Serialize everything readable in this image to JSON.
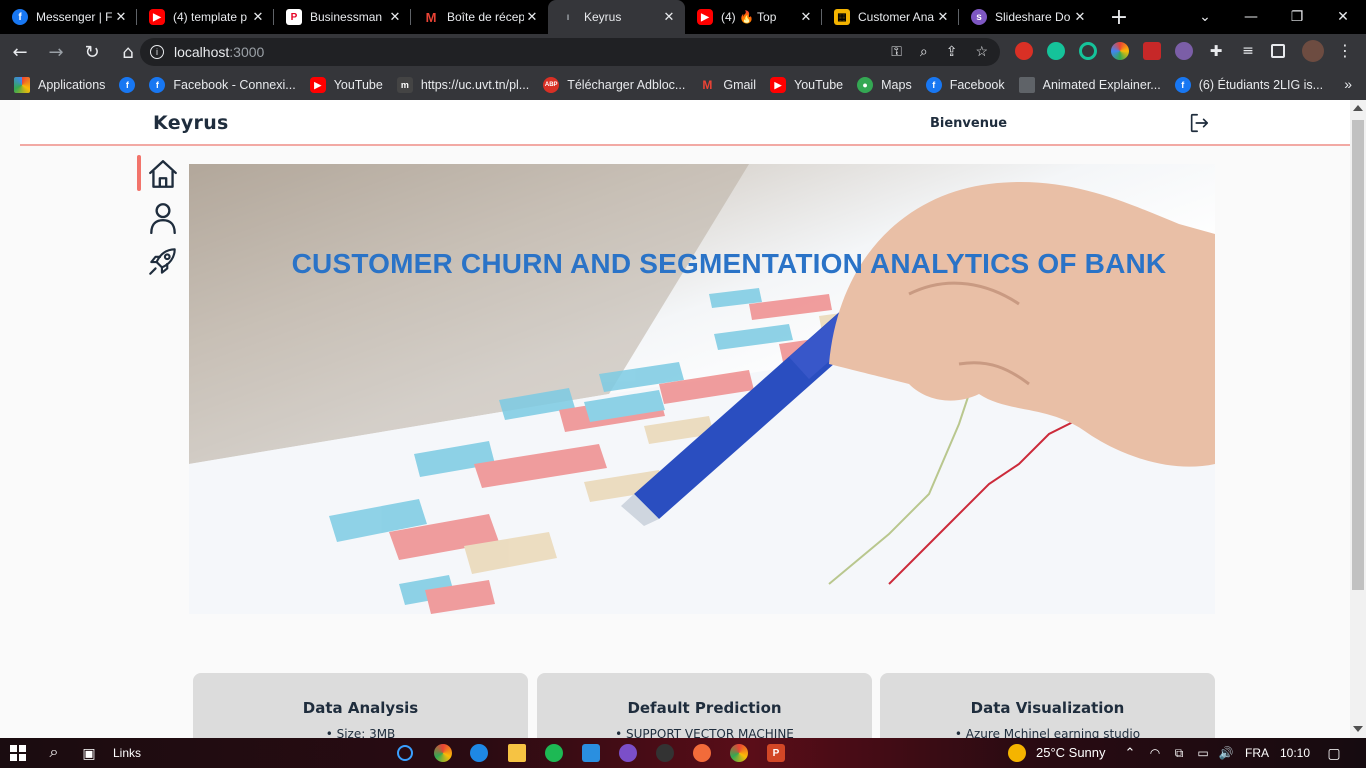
{
  "browser": {
    "tabs": [
      {
        "title": "Messenger | F",
        "icon": "facebook-icon",
        "color": "#1877f2"
      },
      {
        "title": "(4) template p",
        "icon": "youtube-icon",
        "color": "#ff0000"
      },
      {
        "title": "Businessman",
        "icon": "p-logo-icon",
        "color": "#ffffff"
      },
      {
        "title": "Boîte de récep",
        "icon": "gmail-icon",
        "color": "#ea4335"
      },
      {
        "title": "Keyrus",
        "icon": "keyrus-icon",
        "color": "#35363a",
        "active": true
      },
      {
        "title": "(4) 🔥 Top",
        "icon": "youtube-icon",
        "color": "#ff0000"
      },
      {
        "title": "Customer Ana",
        "icon": "analytics-icon",
        "color": "#f4b400"
      },
      {
        "title": "Slideshare Do",
        "icon": "slideshare-icon",
        "color": "#7e57c2"
      }
    ],
    "url_host": "localhost",
    "url_port": ":3000",
    "bookmarks": [
      {
        "label": "Applications",
        "color": "#ea4335"
      },
      {
        "label": "",
        "color": "#1877f2"
      },
      {
        "label": "Facebook - Connexi...",
        "color": "#1877f2"
      },
      {
        "label": "YouTube",
        "color": "#ff0000"
      },
      {
        "label": "https://uc.uvt.tn/pl...",
        "color": "#444444"
      },
      {
        "label": "Télécharger Adbloc...",
        "color": "#d93025"
      },
      {
        "label": "Gmail",
        "color": "#ea4335"
      },
      {
        "label": "YouTube",
        "color": "#ff0000"
      },
      {
        "label": "Maps",
        "color": "#34a853"
      },
      {
        "label": "Facebook",
        "color": "#1877f2"
      },
      {
        "label": "Animated Explainer...",
        "color": "#5f6368"
      },
      {
        "label": "(6) Étudiants 2LIG is...",
        "color": "#1877f2"
      }
    ]
  },
  "app": {
    "brand": "Keyrus",
    "welcome": "Bienvenue",
    "hero_title": "CUSTOMER CHURN AND SEGMENTATION ANALYTICS OF BANK",
    "cards": [
      {
        "title": "Data Analysis",
        "item": "• Size: 3MB"
      },
      {
        "title": "Default Prediction",
        "item": "• SUPPORT VECTOR MACHINE"
      },
      {
        "title": "Data Visualization",
        "item": "• Azure Mchinel earning studio"
      }
    ],
    "accent": "#f2746b",
    "title_color": "#2a73c7"
  },
  "taskbar": {
    "links_label": "Links",
    "weather": "25°C  Sunny",
    "lang": "FRA",
    "time": "10:10"
  }
}
